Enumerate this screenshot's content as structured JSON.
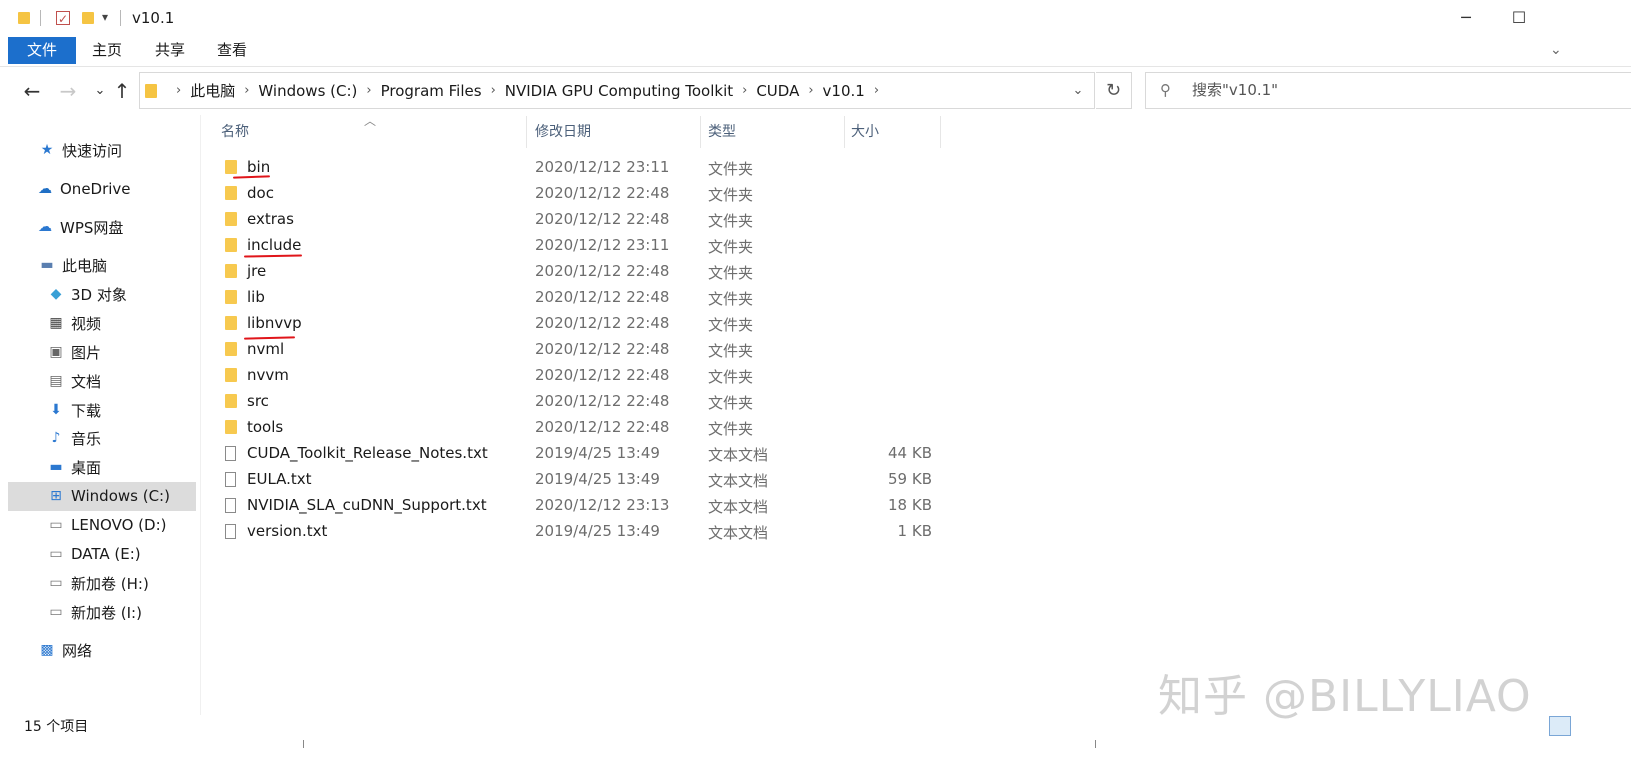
{
  "window": {
    "title": "v10.1",
    "minimize_glyph": "─",
    "maximize_glyph": "☐",
    "qa_dropdown_glyph": "▾"
  },
  "ribbon": {
    "tabs": [
      "文件",
      "主页",
      "共享",
      "查看"
    ]
  },
  "address": {
    "breadcrumbs": [
      "此电脑",
      "Windows (C:)",
      "Program Files",
      "NVIDIA GPU Computing Toolkit",
      "CUDA",
      "v10.1"
    ]
  },
  "search": {
    "placeholder": "搜索\"v10.1\""
  },
  "nav": {
    "items": [
      {
        "label": "快速访问",
        "icon": "star-icon"
      },
      {
        "label": "OneDrive",
        "icon": "cloud-icon"
      },
      {
        "label": "WPS网盘",
        "icon": "cloud-outline-icon"
      },
      {
        "label": "此电脑",
        "icon": "computer-icon"
      },
      {
        "label": "3D 对象",
        "icon": "cube-icon"
      },
      {
        "label": "视频",
        "icon": "film-icon"
      },
      {
        "label": "图片",
        "icon": "picture-icon"
      },
      {
        "label": "文档",
        "icon": "document-icon"
      },
      {
        "label": "下载",
        "icon": "download-icon"
      },
      {
        "label": "音乐",
        "icon": "music-icon"
      },
      {
        "label": "桌面",
        "icon": "desktop-icon"
      },
      {
        "label": "Windows (C:)",
        "icon": "windows-drive-icon"
      },
      {
        "label": "LENOVO (D:)",
        "icon": "drive-icon"
      },
      {
        "label": "DATA (E:)",
        "icon": "drive-icon"
      },
      {
        "label": "新加卷 (H:)",
        "icon": "drive-icon"
      },
      {
        "label": "新加卷 (I:)",
        "icon": "drive-icon"
      },
      {
        "label": "网络",
        "icon": "network-icon"
      }
    ],
    "selected": "Windows (C:)"
  },
  "columns": [
    "名称",
    "修改日期",
    "类型",
    "大小"
  ],
  "files": [
    {
      "name": "bin",
      "date": "2020/12/12 23:11",
      "type": "文件夹",
      "size": "",
      "kind": "folder"
    },
    {
      "name": "doc",
      "date": "2020/12/12 22:48",
      "type": "文件夹",
      "size": "",
      "kind": "folder"
    },
    {
      "name": "extras",
      "date": "2020/12/12 22:48",
      "type": "文件夹",
      "size": "",
      "kind": "folder"
    },
    {
      "name": "include",
      "date": "2020/12/12 23:11",
      "type": "文件夹",
      "size": "",
      "kind": "folder"
    },
    {
      "name": "jre",
      "date": "2020/12/12 22:48",
      "type": "文件夹",
      "size": "",
      "kind": "folder"
    },
    {
      "name": "lib",
      "date": "2020/12/12 22:48",
      "type": "文件夹",
      "size": "",
      "kind": "folder"
    },
    {
      "name": "libnvvp",
      "date": "2020/12/12 22:48",
      "type": "文件夹",
      "size": "",
      "kind": "folder"
    },
    {
      "name": "nvml",
      "date": "2020/12/12 22:48",
      "type": "文件夹",
      "size": "",
      "kind": "folder"
    },
    {
      "name": "nvvm",
      "date": "2020/12/12 22:48",
      "type": "文件夹",
      "size": "",
      "kind": "folder"
    },
    {
      "name": "src",
      "date": "2020/12/12 22:48",
      "type": "文件夹",
      "size": "",
      "kind": "folder"
    },
    {
      "name": "tools",
      "date": "2020/12/12 22:48",
      "type": "文件夹",
      "size": "",
      "kind": "folder"
    },
    {
      "name": "CUDA_Toolkit_Release_Notes.txt",
      "date": "2019/4/25 13:49",
      "type": "文本文档",
      "size": "44 KB",
      "kind": "txt"
    },
    {
      "name": "EULA.txt",
      "date": "2019/4/25 13:49",
      "type": "文本文档",
      "size": "59 KB",
      "kind": "txt"
    },
    {
      "name": "NVIDIA_SLA_cuDNN_Support.txt",
      "date": "2020/12/12 23:13",
      "type": "文本文档",
      "size": "18 KB",
      "kind": "txt"
    },
    {
      "name": "version.txt",
      "date": "2019/4/25 13:49",
      "type": "文本文档",
      "size": "1 KB",
      "kind": "txt"
    }
  ],
  "annotations": {
    "underlined": [
      "bin",
      "include",
      "libnvvp"
    ],
    "color": "#e0151a"
  },
  "status": {
    "item_count": "15 个项目"
  },
  "watermark": "知乎 @BILLYLIAO",
  "colors": {
    "accent": "#1c6fcc",
    "folder": "#f7c94f",
    "selected_bg": "#dcdcdc"
  }
}
